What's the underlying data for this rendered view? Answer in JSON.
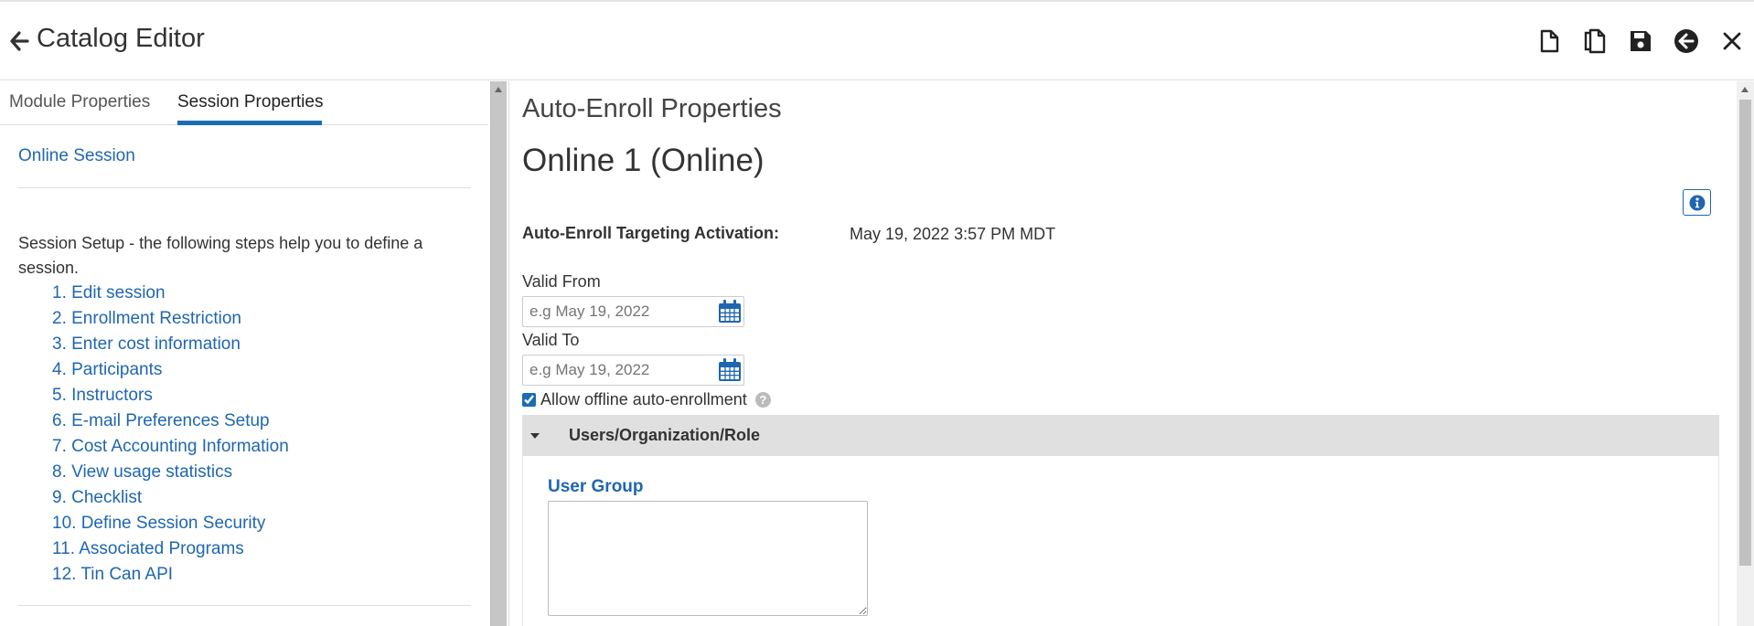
{
  "header": {
    "title": "Catalog Editor",
    "toolbar": [
      "new-document-icon",
      "copy-icon",
      "save-icon",
      "back-circle-icon",
      "close-icon"
    ]
  },
  "sidebar": {
    "tabs": [
      {
        "label": "Module Properties"
      },
      {
        "label": "Session Properties"
      }
    ],
    "active_tab": "Session Properties",
    "session_link": "Online Session",
    "setup_text": "Session Setup - the following steps help you to define a session.",
    "steps": [
      "1. Edit session",
      "2. Enrollment Restriction",
      "3. Enter cost information",
      "4. Participants",
      "5. Instructors",
      "6. E-mail Preferences Setup",
      "7. Cost Accounting Information",
      "8. View usage statistics",
      "9. Checklist",
      "10. Define Session Security",
      "11. Associated Programs",
      "12. Tin Can API"
    ]
  },
  "main": {
    "section_title": "Auto-Enroll Properties",
    "session_title": "Online 1 (Online)",
    "activation_label": "Auto-Enroll Targeting Activation:",
    "activation_value": "May 19, 2022 3:57 PM MDT",
    "valid_from": {
      "label": "Valid From",
      "placeholder": "e.g May 19, 2022",
      "value": ""
    },
    "valid_to": {
      "label": "Valid To",
      "placeholder": "e.g May 19, 2022",
      "value": ""
    },
    "offline_checkbox": {
      "label": "Allow offline auto-enrollment",
      "checked": true
    },
    "help_glyph": "?",
    "accordion": {
      "label": "Users/Organization/Role",
      "expanded": true
    },
    "user_group": {
      "label": "User Group",
      "value": ""
    }
  },
  "colors": {
    "accent": "#1a6db5",
    "link": "#1f66b0",
    "accordion_bg": "#e0e0e0"
  }
}
